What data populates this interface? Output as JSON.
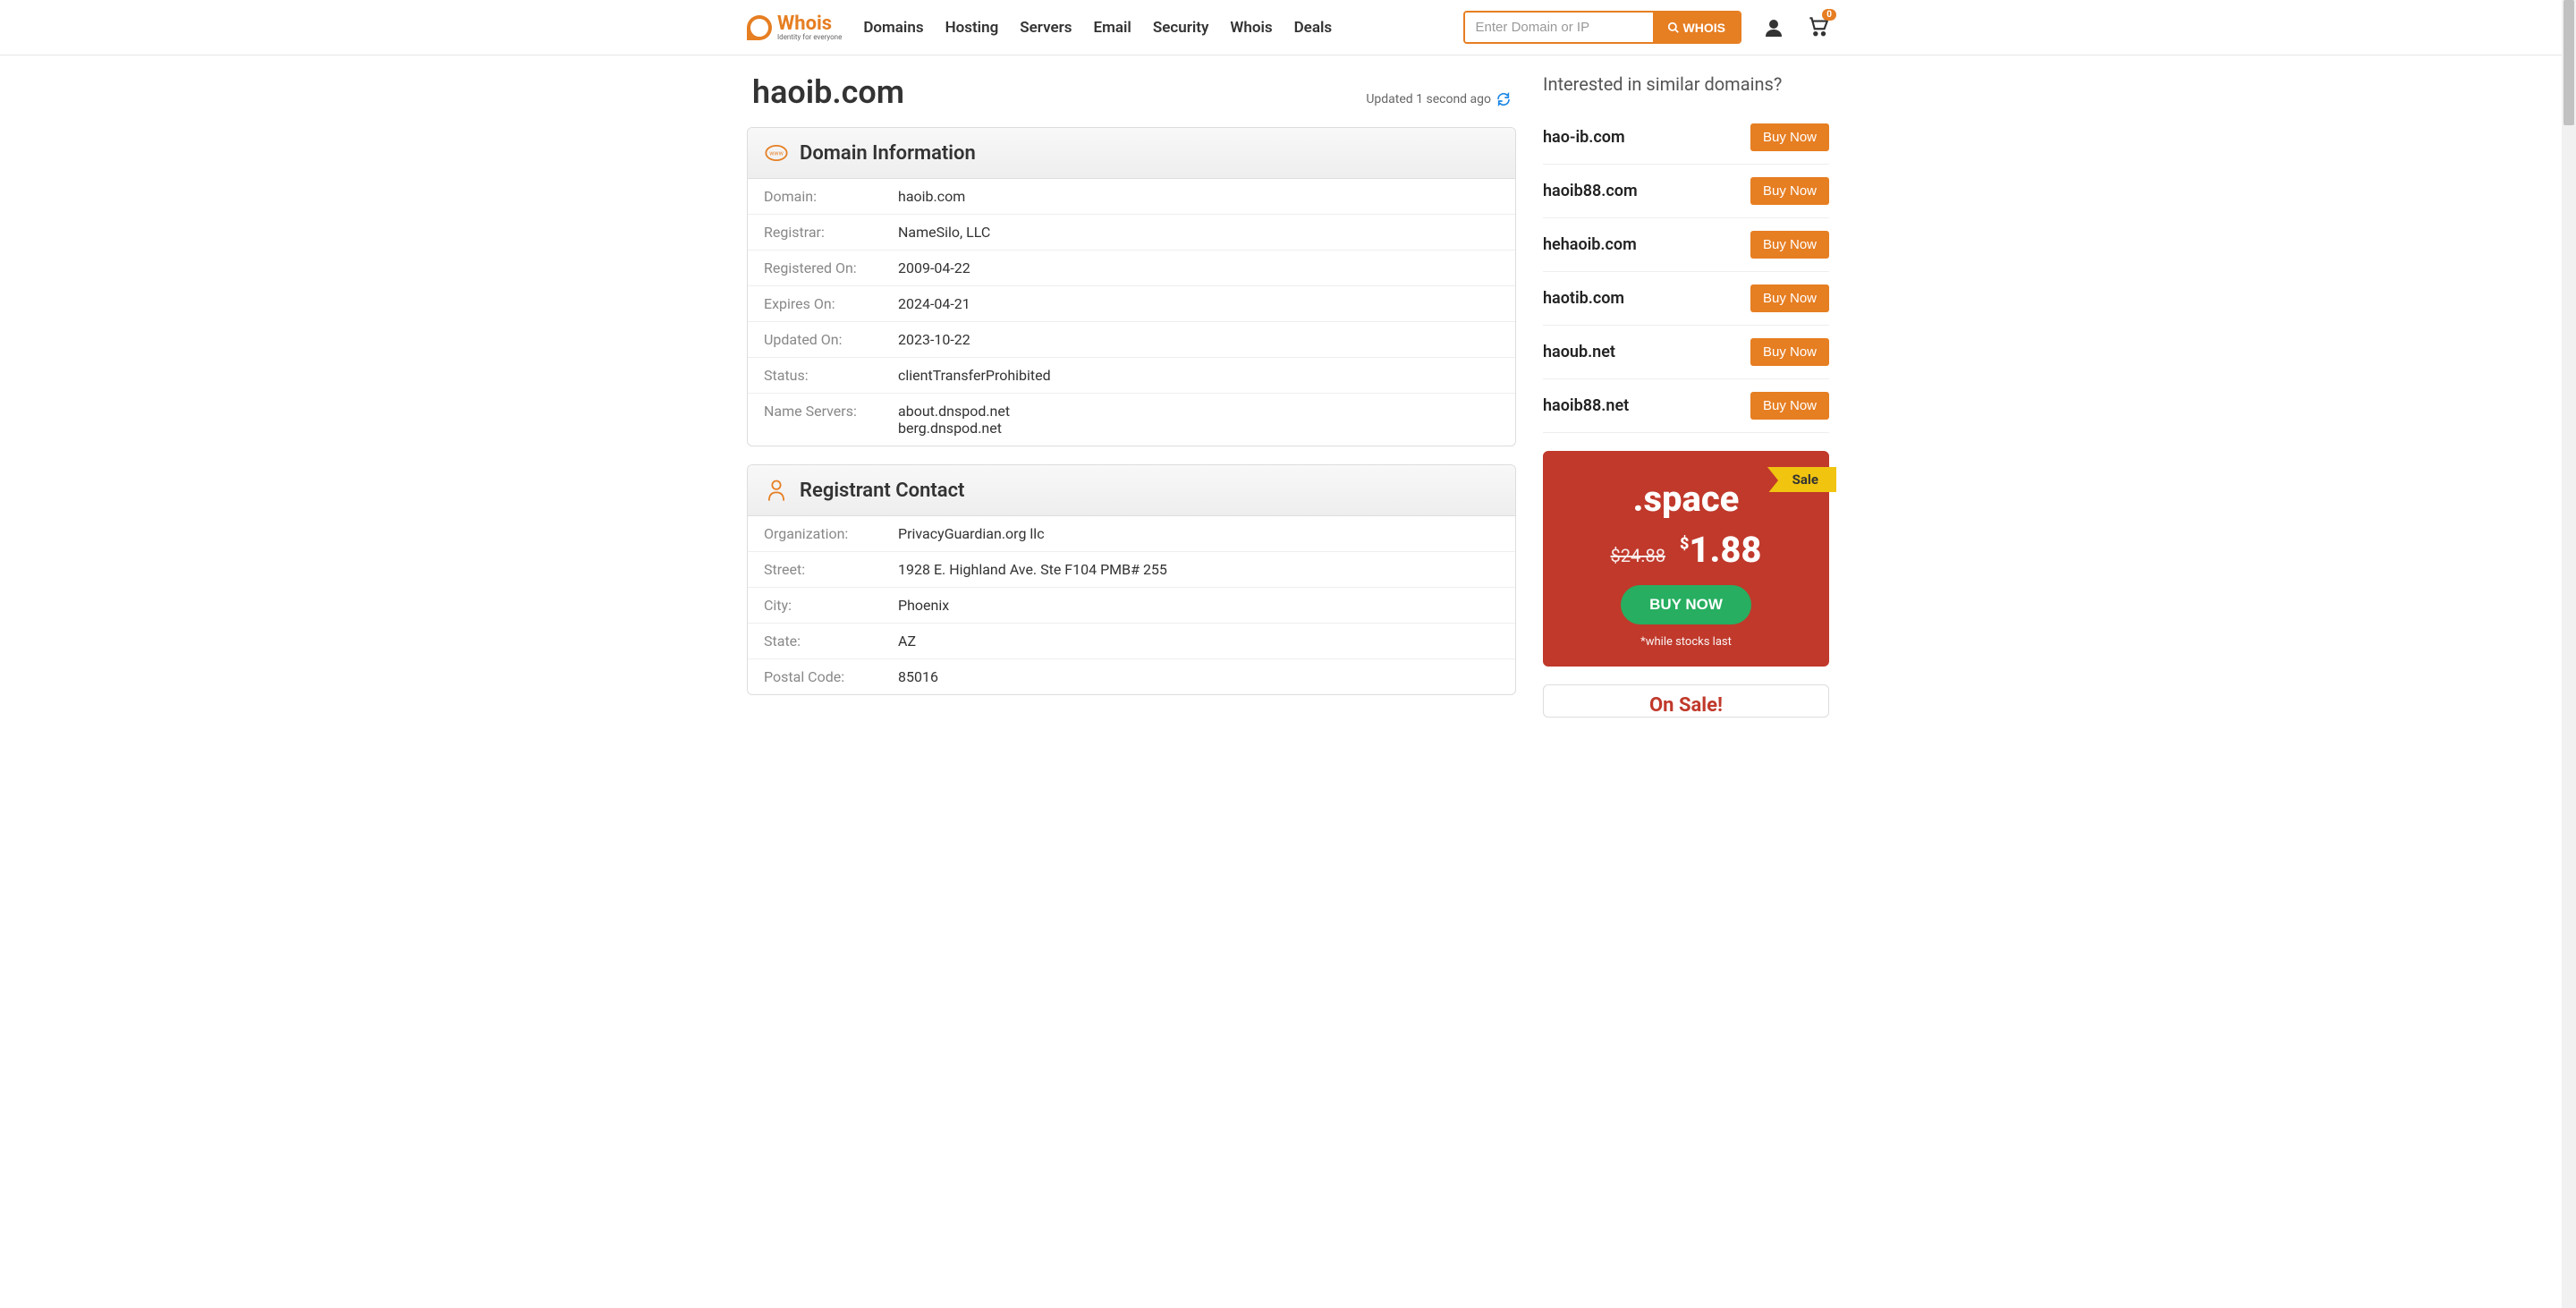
{
  "logo": {
    "title": "Whois",
    "subtitle": "Identity for everyone"
  },
  "nav": [
    "Domains",
    "Hosting",
    "Servers",
    "Email",
    "Security",
    "Whois",
    "Deals"
  ],
  "search": {
    "placeholder": "Enter Domain or IP",
    "button": "WHOIS"
  },
  "cart": {
    "count": "0"
  },
  "page": {
    "title": "haoib.com",
    "updated": "Updated 1 second ago"
  },
  "domainInfo": {
    "title": "Domain Information",
    "rows": [
      {
        "label": "Domain:",
        "value": "haoib.com"
      },
      {
        "label": "Registrar:",
        "value": "NameSilo, LLC"
      },
      {
        "label": "Registered On:",
        "value": "2009-04-22"
      },
      {
        "label": "Expires On:",
        "value": "2024-04-21"
      },
      {
        "label": "Updated On:",
        "value": "2023-10-22"
      },
      {
        "label": "Status:",
        "value": "clientTransferProhibited"
      },
      {
        "label": "Name Servers:",
        "value": "about.dnspod.net\nberg.dnspod.net"
      }
    ]
  },
  "registrant": {
    "title": "Registrant Contact",
    "rows": [
      {
        "label": "Organization:",
        "value": "PrivacyGuardian.org llc"
      },
      {
        "label": "Street:",
        "value": "1928 E. Highland Ave. Ste F104 PMB# 255"
      },
      {
        "label": "City:",
        "value": "Phoenix"
      },
      {
        "label": "State:",
        "value": "AZ"
      },
      {
        "label": "Postal Code:",
        "value": "85016"
      }
    ]
  },
  "similar": {
    "title": "Interested in similar domains?",
    "buyLabel": "Buy Now",
    "items": [
      "hao-ib.com",
      "haoib88.com",
      "hehaoib.com",
      "haotib.com",
      "haoub.net",
      "haoib88.net"
    ]
  },
  "promo": {
    "ribbon": "Sale",
    "tld": ".space",
    "oldPrice": "$24.88",
    "newCurrency": "$",
    "newPrice": "1.88",
    "button": "BUY NOW",
    "note": "*while stocks last"
  },
  "onsale": {
    "text": "On Sale!"
  }
}
